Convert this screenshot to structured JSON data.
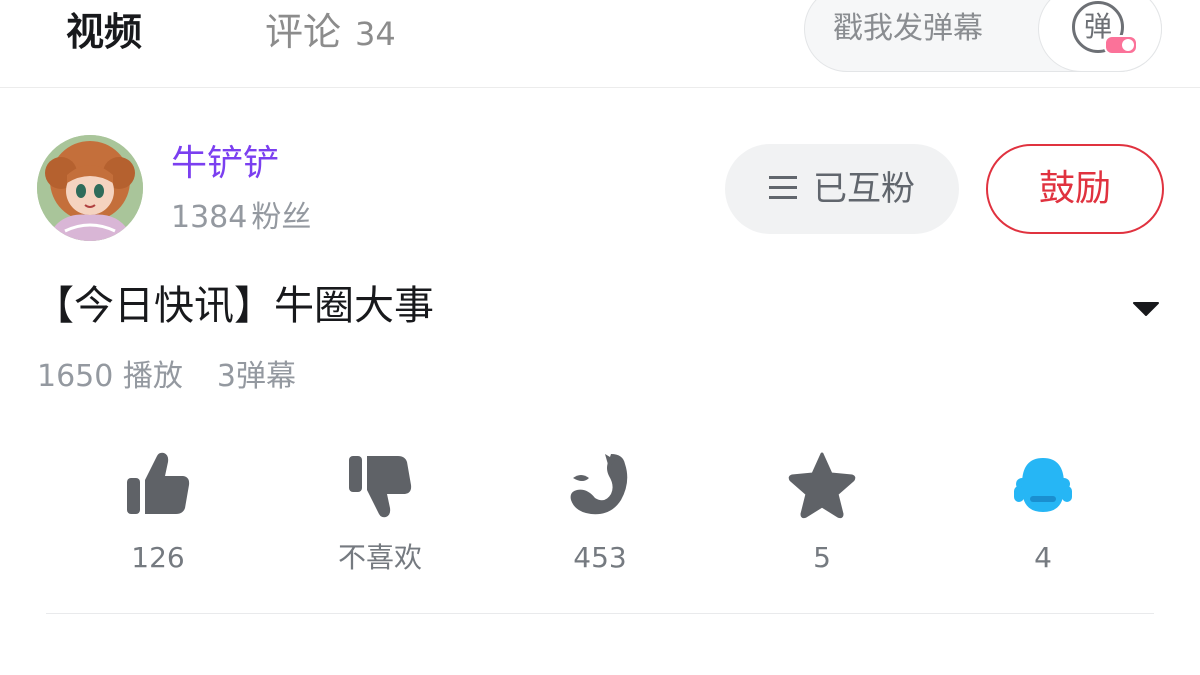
{
  "tabs": {
    "video_label": "视频",
    "comment_label": "评论",
    "comment_count": "34"
  },
  "danmaku": {
    "placeholder": "戳我发弹幕",
    "toggle_glyph": "弹"
  },
  "author": {
    "name": "牛铲铲",
    "fans_count": "1384",
    "fans_label": "粉丝",
    "followed_label": "已互粉",
    "encourage_label": "鼓励"
  },
  "video": {
    "title": "【今日快讯】牛圈大事",
    "play_count": "1650",
    "play_label": "播放",
    "danmaku_count": "3",
    "danmaku_label": "弹幕"
  },
  "actions": {
    "like": {
      "icon": "thumbs-up-icon",
      "label": "126"
    },
    "dislike": {
      "icon": "thumbs-down-icon",
      "label": "不喜欢"
    },
    "coin": {
      "icon": "coin-icon",
      "label": "453"
    },
    "favorite": {
      "icon": "star-icon",
      "label": "5"
    },
    "share": {
      "icon": "share-icon",
      "label": "4"
    }
  },
  "colors": {
    "accent_pink": "#fb7299",
    "author_purple": "#7b3ff0",
    "encourage_red": "#e0323f",
    "icon_gray": "#5f6267",
    "share_blue": "#26b6f5"
  }
}
